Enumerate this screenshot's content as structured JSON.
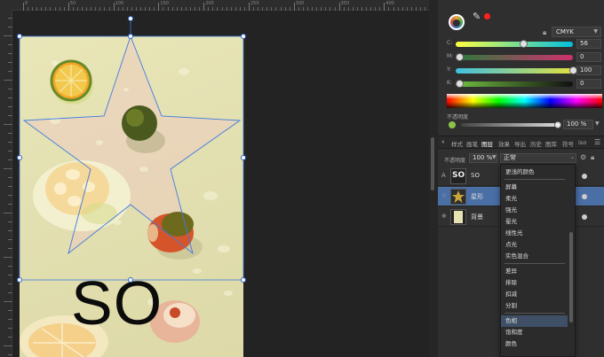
{
  "ruler": {
    "labels": [
      "0",
      "50",
      "100",
      "150",
      "200",
      "250",
      "300",
      "350",
      "400",
      "450"
    ]
  },
  "canvas": {
    "text_content": "SO"
  },
  "color_panel": {
    "model": "CMYK",
    "channels": [
      {
        "label": "C:",
        "value": "56",
        "fraction": 0.56,
        "gradient": "linear-gradient(to right, #ffff40, #00c0e0)"
      },
      {
        "label": "M:",
        "value": "0",
        "fraction": 0.0,
        "gradient": "linear-gradient(to right, #2a7a3a, #d03070)"
      },
      {
        "label": "Y:",
        "value": "100",
        "fraction": 1.0,
        "gradient": "linear-gradient(to right, #40c0e0, #e0e040)"
      },
      {
        "label": "K:",
        "value": "0",
        "fraction": 0.0,
        "gradient": "linear-gradient(to right, #70c040, #101010)"
      }
    ],
    "opacity_label": "不透明度",
    "opacity_value": "100 %"
  },
  "tabs": [
    "样式",
    "画笔",
    "图层",
    "效果",
    "导出",
    "历史",
    "图库",
    "符号",
    "iso"
  ],
  "active_tab": "图层",
  "layers_toolbar": {
    "opacity_label": "不透明度",
    "opacity_value": "100 %",
    "blend_mode": "正常"
  },
  "layers": [
    {
      "type": "A",
      "name": "SO",
      "selected": false,
      "thumb": "text"
    },
    {
      "type": "☆",
      "name": "星形",
      "selected": true,
      "thumb": "star"
    },
    {
      "type": "※",
      "name": "背景",
      "selected": false,
      "thumb": "image"
    }
  ],
  "blend_dropdown": {
    "items": [
      {
        "label": "更浅的颜色",
        "sep_after": true
      },
      {
        "label": "屏幕",
        "sep_after": false
      },
      {
        "label": "柔光",
        "sep_after": false
      },
      {
        "label": "强光",
        "sep_after": false
      },
      {
        "label": "晕光",
        "sep_after": false
      },
      {
        "label": "线性光",
        "sep_after": false
      },
      {
        "label": "点光",
        "sep_after": false
      },
      {
        "label": "实色混合",
        "sep_after": true
      },
      {
        "label": "差异",
        "sep_after": false
      },
      {
        "label": "排除",
        "sep_after": false
      },
      {
        "label": "扣减",
        "sep_after": false
      },
      {
        "label": "分割",
        "sep_after": true
      },
      {
        "label": "色相",
        "sep_after": false
      },
      {
        "label": "饱和度",
        "sep_after": false
      },
      {
        "label": "颜色",
        "sep_after": false
      }
    ],
    "highlighted": "色相"
  },
  "colors": {
    "selection_blue": "#2a63c9",
    "accent_red": "#ff2020",
    "layer_selected": "#4a6fa5"
  }
}
